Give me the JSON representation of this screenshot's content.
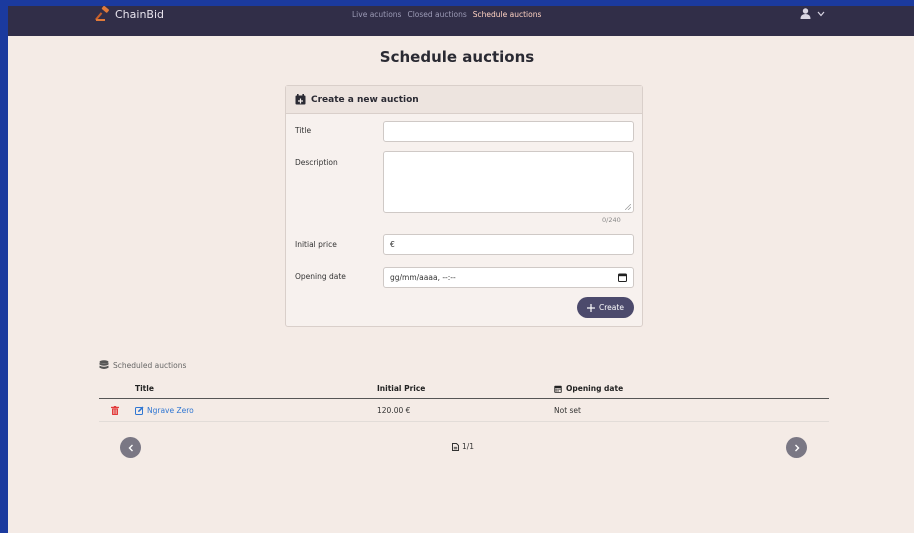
{
  "brand": {
    "name": "ChainBid"
  },
  "nav": {
    "links": [
      "Live acutions",
      "Closed auctions",
      "Schedule auctions"
    ]
  },
  "page": {
    "title": "Schedule auctions"
  },
  "form": {
    "header": "Create a new auction",
    "title_label": "Title",
    "description_label": "Description",
    "description_counter": "0/240",
    "initial_price_label": "Initial price",
    "price_prefix": "€",
    "opening_date_label": "Opening date",
    "opening_date_placeholder": "gg/mm/aaaa, --:--",
    "create_label": "Create"
  },
  "scheduled": {
    "label": "Scheduled auctions",
    "columns": [
      "Title",
      "Initial Price",
      "Opening date"
    ],
    "rows": [
      {
        "title": "Ngrave Zero",
        "price": "120.00 €",
        "opening": "Not set"
      }
    ],
    "pagination": "1/1"
  },
  "colors": {
    "navbar": "#312e48",
    "background": "#f4ebe6",
    "accent": "#4c4a6c",
    "link": "#2f76d2",
    "delete": "#e23b3b",
    "active_nav": "#ffd2c2"
  }
}
